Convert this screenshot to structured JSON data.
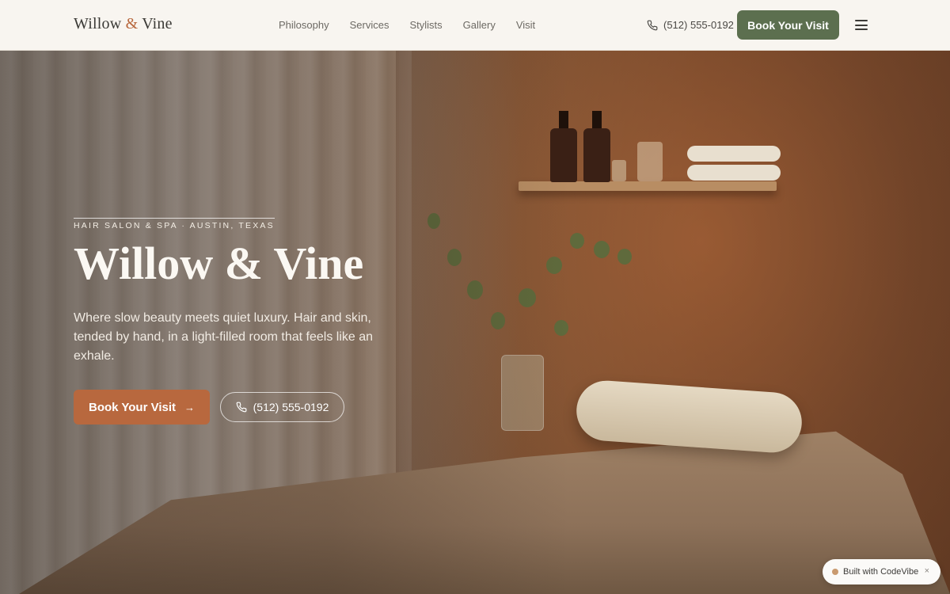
{
  "header": {
    "logo_part1": "Willow",
    "logo_amp": "&",
    "logo_part2": "Vine",
    "nav": [
      "Philosophy",
      "Services",
      "Stylists",
      "Gallery",
      "Visit"
    ],
    "phone": "(512) 555-0192",
    "book_label": "Book Your Visit",
    "menu_icon": "hamburger-menu-icon"
  },
  "hero": {
    "eyebrow": "HAIR SALON & SPA · AUSTIN, TEXAS",
    "title": "Willow & Vine",
    "description": "Where slow beauty meets quiet luxury. Hair and skin, tended by hand, in a light-filled room that feels like an exhale.",
    "book_label": "Book Your Visit",
    "book_arrow": "→",
    "phone": "(512) 555-0192"
  },
  "badge": {
    "label": "Built with CodeVibe",
    "close": "×"
  },
  "colors": {
    "accent": "#b8683e",
    "brand_green": "#5c6f4f",
    "header_bg": "#f8f5f0"
  }
}
